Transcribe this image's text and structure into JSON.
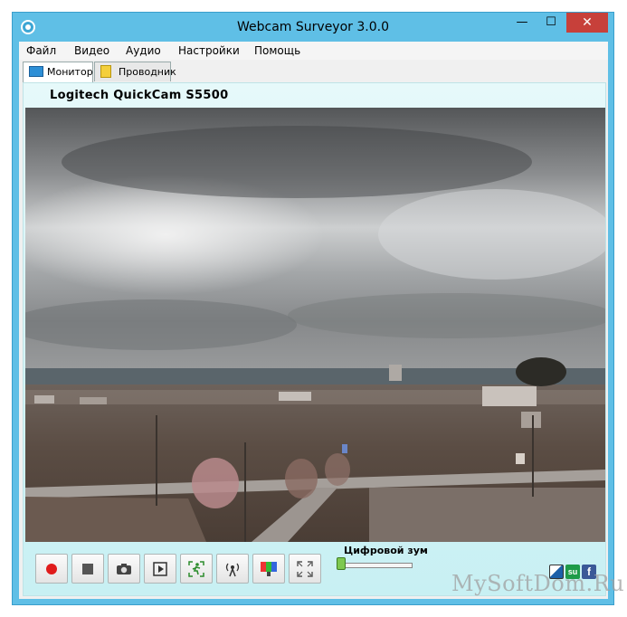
{
  "window": {
    "title": "Webcam Surveyor 3.0.0",
    "minimize_glyph": "—",
    "maximize_glyph": "☐",
    "close_glyph": "✕"
  },
  "menu": {
    "items": [
      "Файл",
      "Видео",
      "Аудио",
      "Настройки",
      "Помощь"
    ]
  },
  "tabs": [
    {
      "label": "Монитор",
      "icon": "monitor-icon",
      "active": true
    },
    {
      "label": "Проводник",
      "icon": "folder-icon",
      "active": false
    }
  ],
  "camera": {
    "name": "Logitech QuickCam S5500"
  },
  "controls": {
    "buttons": [
      "record-icon",
      "stop-icon",
      "snapshot-icon",
      "playback-icon",
      "motion-detect-icon",
      "broadcast-icon",
      "color-settings-icon",
      "fullscreen-icon"
    ]
  },
  "zoom": {
    "label": "Цифровой зум",
    "value": 0
  },
  "social": {
    "s2_text": "su",
    "s3_text": "f"
  },
  "watermark": "MySoftDom.Ru",
  "colors": {
    "title_bar": "#5fbfe6",
    "close_button": "#c7403a",
    "record": "#e01b1b",
    "panel": "#d8f5f7"
  }
}
